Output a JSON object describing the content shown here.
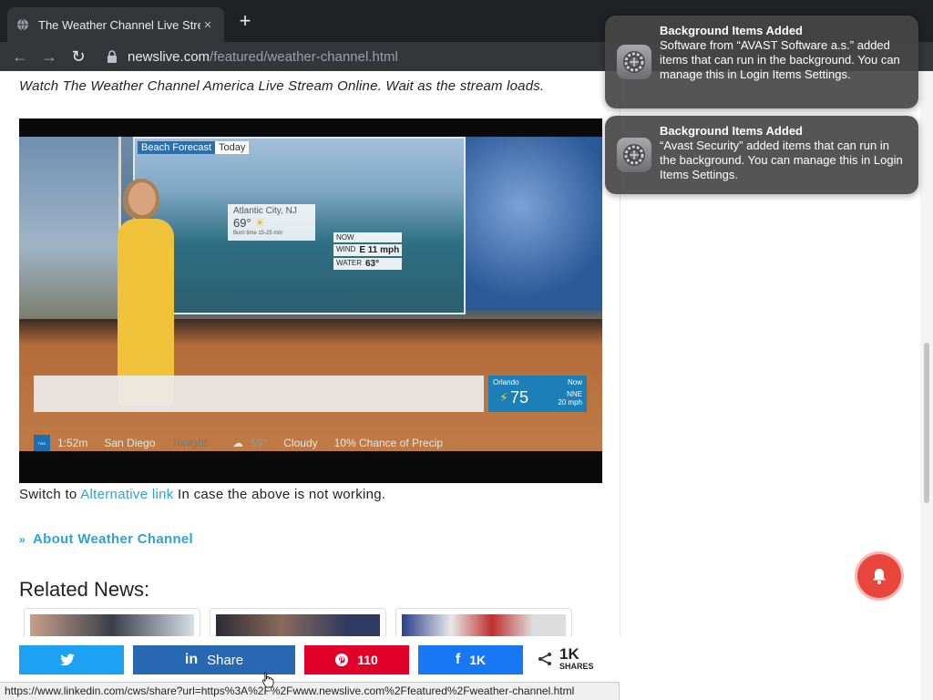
{
  "browser": {
    "tab_title": "The Weather Channel Live Stre",
    "tab_close": "×",
    "new_tab": "+",
    "url_domain": "newslive.com",
    "url_path": "/featured/weather-channel.html"
  },
  "page": {
    "intro": "Watch The Weather Channel America Live Stream Online. Wait as the stream loads.",
    "video": {
      "tag_label": "Beach Forecast",
      "tag_day": "Today",
      "card_city": "Atlantic City, NJ",
      "card_temp": "69°",
      "card_sub": "Burn time 15-25 min",
      "now_label": "NOW",
      "wind_label": "WIND",
      "wind_value": "E 11 mph",
      "water_label": "WATER",
      "water_value": "63°",
      "orlando_city": "Orlando",
      "orlando_now": "Now",
      "orlando_temp": "75",
      "orlando_wind_dir": "NNE",
      "orlando_wind_speed": "20 mph",
      "ticker_logo": "The Weather Channel",
      "ticker_time": "1:52m",
      "ticker_city": "San Diego",
      "ticker_period": "Tonight",
      "ticker_temp": "59°",
      "ticker_cond": "Cloudy",
      "ticker_precip": "10% Chance of Precip"
    },
    "switch_prefix": "Switch to",
    "switch_link": "Alternative link",
    "switch_suffix": "In case the above is not working.",
    "about_link": "About Weather Channel",
    "related_title": "Related News:"
  },
  "share": {
    "twitter_label": "",
    "linkedin_label": "Share",
    "pinterest_count": "110",
    "facebook_count": "1K",
    "total_count": "1K",
    "total_label": "SHARES"
  },
  "status_url": "https://www.linkedin.com/cws/share?url=https%3A%2F%2Fwww.newslive.com%2Ffeatured%2Fweather-channel.html",
  "notifications": [
    {
      "title": "Background Items Added",
      "body": "Software from “AVAST Software a.s.” added items that can run in the background. You can manage this in Login Items Settings."
    },
    {
      "title": "Background Items Added",
      "body": "“Avast Security” added items that can run in the background. You can manage this in Login Items Settings."
    }
  ],
  "colors": {
    "link": "#2ea3d6",
    "twitter": "#1da1f2",
    "linkedin": "#2867b2",
    "pinterest": "#e0002a",
    "facebook": "#1877f2",
    "bell": "#e8453c"
  }
}
